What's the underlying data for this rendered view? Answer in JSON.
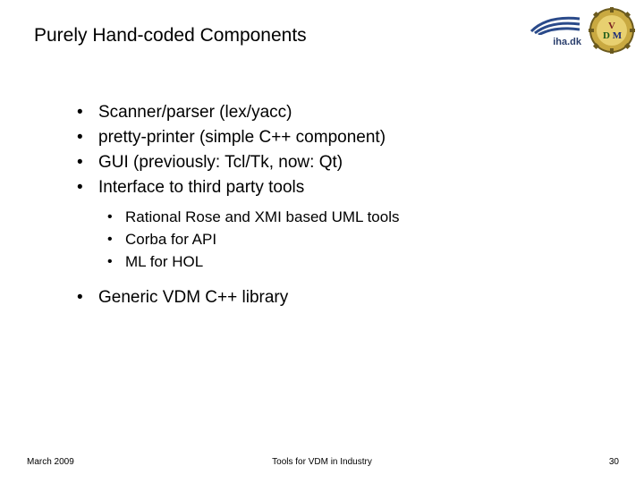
{
  "title": "Purely Hand-coded Components",
  "logos": {
    "iha_text": "iha.dk"
  },
  "bullets": {
    "main": [
      "Scanner/parser (lex/yacc)",
      "pretty-printer (simple C++ component)",
      "GUI (previously: Tcl/Tk, now: Qt)",
      "Interface to third party tools"
    ],
    "sub": [
      "Rational Rose and XMI based UML tools",
      "Corba for API",
      "ML for HOL"
    ],
    "main2": [
      "Generic VDM C++ library"
    ]
  },
  "footer": {
    "date": "March 2009",
    "center": "Tools for VDM in Industry",
    "page": "30"
  }
}
